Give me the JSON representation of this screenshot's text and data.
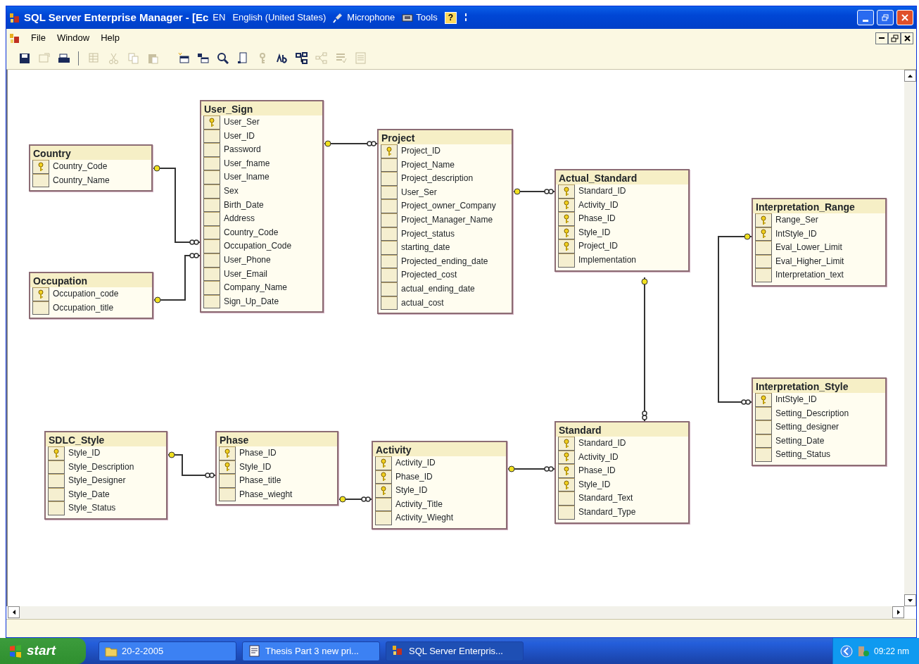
{
  "window": {
    "title": "SQL Server Enterprise Manager - [Ec"
  },
  "language_bar": {
    "code": "EN",
    "language": "English (United States)",
    "items": [
      {
        "kind": "microphone",
        "label": "Microphone"
      },
      {
        "kind": "tools",
        "label": "Tools"
      }
    ],
    "help": "?"
  },
  "menu": [
    "File",
    "Window",
    "Help"
  ],
  "toolbar": [
    {
      "kind": "save",
      "disabled": false
    },
    {
      "kind": "properties",
      "disabled": true
    },
    {
      "kind": "print",
      "disabled": false
    },
    {
      "kind": "table-properties",
      "disabled": true
    },
    {
      "kind": "cut",
      "disabled": true
    },
    {
      "kind": "copy",
      "disabled": true
    },
    {
      "kind": "paste",
      "disabled": true
    },
    {
      "kind": "new-table",
      "disabled": false
    },
    {
      "kind": "add-table",
      "disabled": false
    },
    {
      "kind": "zoom",
      "disabled": false
    },
    {
      "kind": "page",
      "disabled": false
    },
    {
      "kind": "key",
      "disabled": true
    },
    {
      "kind": "rename",
      "disabled": false
    },
    {
      "kind": "relationships",
      "disabled": false
    },
    {
      "kind": "indexes",
      "disabled": true
    },
    {
      "kind": "constraints",
      "disabled": true
    },
    {
      "kind": "grid",
      "disabled": true
    }
  ],
  "tables": [
    {
      "name": "Country",
      "columns": [
        {
          "name": "Country_Code",
          "key": true
        },
        {
          "name": "Country_Name",
          "key": false
        }
      ]
    },
    {
      "name": "Occupation",
      "columns": [
        {
          "name": "Occupation_code",
          "key": true
        },
        {
          "name": "Occupation_title",
          "key": false
        }
      ]
    },
    {
      "name": "User_Sign",
      "columns": [
        {
          "name": "User_Ser",
          "key": true
        },
        {
          "name": "User_ID",
          "key": false
        },
        {
          "name": "Password",
          "key": false
        },
        {
          "name": "User_fname",
          "key": false
        },
        {
          "name": "User_lname",
          "key": false
        },
        {
          "name": "Sex",
          "key": false
        },
        {
          "name": "Birth_Date",
          "key": false
        },
        {
          "name": "Address",
          "key": false
        },
        {
          "name": "Country_Code",
          "key": false
        },
        {
          "name": "Occupation_Code",
          "key": false
        },
        {
          "name": "User_Phone",
          "key": false
        },
        {
          "name": "User_Email",
          "key": false
        },
        {
          "name": "Company_Name",
          "key": false
        },
        {
          "name": "Sign_Up_Date",
          "key": false
        }
      ]
    },
    {
      "name": "Project",
      "columns": [
        {
          "name": "Project_ID",
          "key": true
        },
        {
          "name": "Project_Name",
          "key": false
        },
        {
          "name": "Project_description",
          "key": false
        },
        {
          "name": "User_Ser",
          "key": false
        },
        {
          "name": "Project_owner_Company",
          "key": false
        },
        {
          "name": "Project_Manager_Name",
          "key": false
        },
        {
          "name": "Project_status",
          "key": false
        },
        {
          "name": "starting_date",
          "key": false
        },
        {
          "name": "Projected_ending_date",
          "key": false
        },
        {
          "name": "Projected_cost",
          "key": false
        },
        {
          "name": "actual_ending_date",
          "key": false
        },
        {
          "name": "actual_cost",
          "key": false
        }
      ]
    },
    {
      "name": "Actual_Standard",
      "columns": [
        {
          "name": "Standard_ID",
          "key": true
        },
        {
          "name": "Activity_ID",
          "key": true
        },
        {
          "name": "Phase_ID",
          "key": true
        },
        {
          "name": "Style_ID",
          "key": true
        },
        {
          "name": "Project_ID",
          "key": true
        },
        {
          "name": "Implementation",
          "key": false
        }
      ]
    },
    {
      "name": "Interpretation_Range",
      "columns": [
        {
          "name": "Range_Ser",
          "key": true
        },
        {
          "name": "IntStyle_ID",
          "key": true
        },
        {
          "name": "Eval_Lower_Limit",
          "key": false
        },
        {
          "name": "Eval_Higher_Limit",
          "key": false
        },
        {
          "name": "Interpretation_text",
          "key": false
        }
      ]
    },
    {
      "name": "Interpretation_Style",
      "columns": [
        {
          "name": "IntStyle_ID",
          "key": true
        },
        {
          "name": "Setting_Description",
          "key": false
        },
        {
          "name": "Setting_designer",
          "key": false
        },
        {
          "name": "Setting_Date",
          "key": false
        },
        {
          "name": "Setting_Status",
          "key": false
        }
      ]
    },
    {
      "name": "SDLC_Style",
      "columns": [
        {
          "name": "Style_ID",
          "key": true
        },
        {
          "name": "Style_Description",
          "key": false
        },
        {
          "name": "Style_Designer",
          "key": false
        },
        {
          "name": "Style_Date",
          "key": false
        },
        {
          "name": "Style_Status",
          "key": false
        }
      ]
    },
    {
      "name": "Phase",
      "columns": [
        {
          "name": "Phase_ID",
          "key": true
        },
        {
          "name": "Style_ID",
          "key": true
        },
        {
          "name": "Phase_title",
          "key": false
        },
        {
          "name": "Phase_wieght",
          "key": false
        }
      ]
    },
    {
      "name": "Activity",
      "columns": [
        {
          "name": "Activity_ID",
          "key": true
        },
        {
          "name": "Phase_ID",
          "key": true
        },
        {
          "name": "Style_ID",
          "key": true
        },
        {
          "name": "Activity_Title",
          "key": false
        },
        {
          "name": "Activity_Wieght",
          "key": false
        }
      ]
    },
    {
      "name": "Standard",
      "columns": [
        {
          "name": "Standard_ID",
          "key": true
        },
        {
          "name": "Activity_ID",
          "key": true
        },
        {
          "name": "Phase_ID",
          "key": true
        },
        {
          "name": "Style_ID",
          "key": true
        },
        {
          "name": "Standard_Text",
          "key": false
        },
        {
          "name": "Standard_Type",
          "key": false
        }
      ]
    }
  ],
  "taskbar": {
    "start": "start",
    "tasks": [
      {
        "kind": "folder",
        "label": "20-2-2005",
        "selected": false
      },
      {
        "kind": "document",
        "label": "Thesis Part 3 new pri...",
        "selected": false
      },
      {
        "kind": "app",
        "label": "SQL Server Enterpris...",
        "selected": true
      }
    ],
    "clock": "09:22 nm"
  }
}
